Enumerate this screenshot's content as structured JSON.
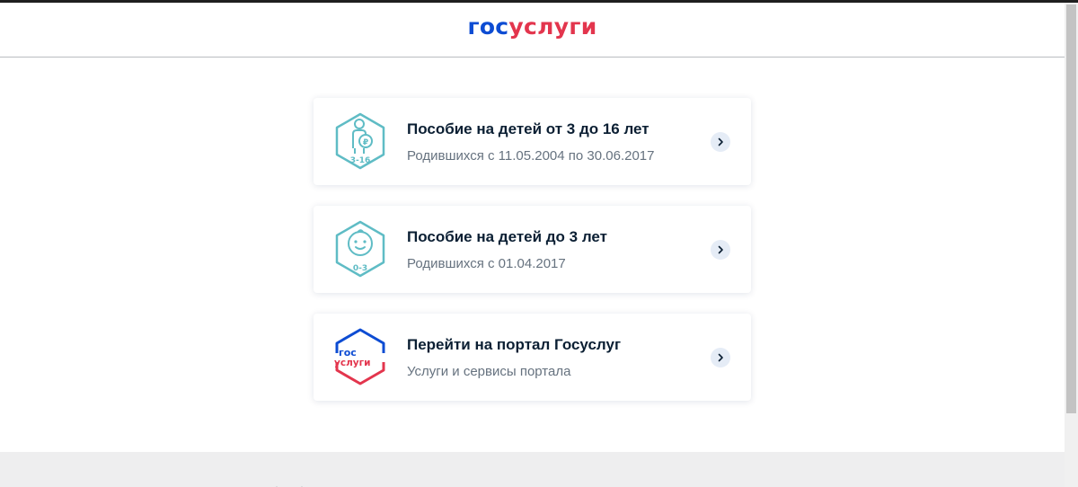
{
  "header": {
    "logo_gos": "гос",
    "logo_uslugi": "услуги"
  },
  "cards": [
    {
      "title": "Пособие на детей от 3 до 16 лет",
      "subtitle": "Родившихся с 11.05.2004 по 30.06.2017",
      "icon": "child-3-16-icon",
      "icon_label": "3-16"
    },
    {
      "title": "Пособие на детей до 3 лет",
      "subtitle": "Родившихся с 01.04.2017",
      "icon": "baby-0-3-icon",
      "icon_label": "0-3"
    },
    {
      "title": "Перейти на портал Госуслуг",
      "subtitle": "Услуги и сервисы портала",
      "icon": "gosuslugi-logo-icon",
      "icon_label_top": "гос",
      "icon_label_bottom": "услуги"
    }
  ],
  "colors": {
    "brand_blue": "#0d4cd3",
    "brand_red": "#e3354d",
    "icon_teal": "#5fbcc5",
    "chevron_bg": "#e5ecf6"
  }
}
